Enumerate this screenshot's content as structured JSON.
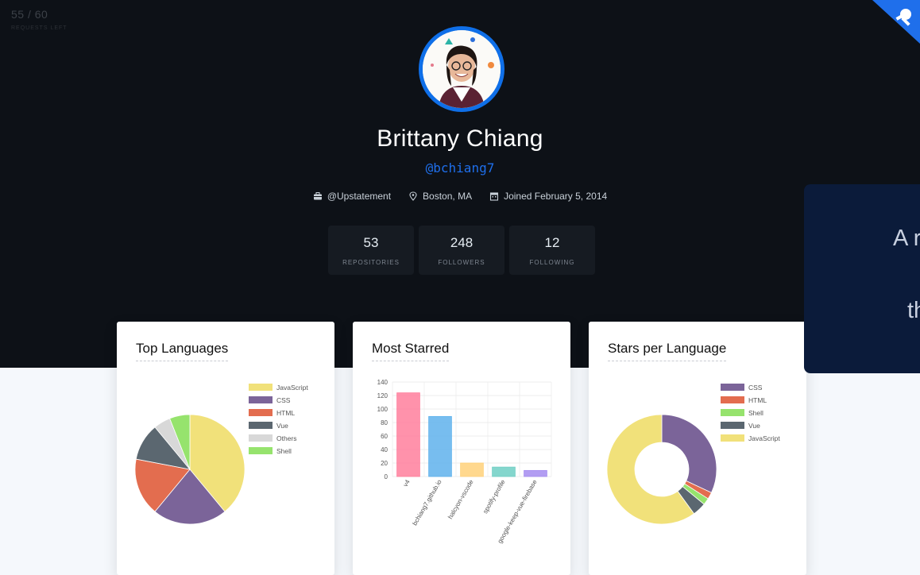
{
  "rate_limit": {
    "count": "55 / 60",
    "label": "REQUESTS LEFT"
  },
  "profile": {
    "name": "Brittany Chiang",
    "handle": "@bchiang7",
    "company": "@Upstatement",
    "location": "Boston, MA",
    "joined": "Joined February 5, 2014"
  },
  "stats": [
    {
      "value": "53",
      "label": "REPOSITORIES"
    },
    {
      "value": "248",
      "label": "FOLLOWERS"
    },
    {
      "value": "12",
      "label": "FOLLOWING"
    }
  ],
  "cards": {
    "top_languages": "Top Languages",
    "most_starred": "Most Starred",
    "stars_per_language": "Stars per Language"
  },
  "popup": {
    "line1": "A r",
    "line2": "th"
  },
  "colors": {
    "accent": "#1f6feb",
    "JavaScript": "#f1e17a",
    "CSS": "#7b6499",
    "HTML": "#e36d4f",
    "Vue": "#5b6770",
    "Others": "#d8d8d8",
    "Shell": "#96e36d"
  },
  "icons": [
    "briefcase-icon",
    "location-pin-icon",
    "calendar-icon",
    "github-octocat-icon"
  ],
  "chart_data": [
    {
      "type": "pie",
      "title": "Top Languages",
      "labels": [
        "JavaScript",
        "CSS",
        "HTML",
        "Vue",
        "Others",
        "Shell"
      ],
      "values": [
        39,
        22,
        17,
        11,
        5,
        6
      ],
      "legend": "top-right"
    },
    {
      "type": "bar",
      "title": "Most Starred",
      "categories": [
        "v4",
        "bchiang7.github.io",
        "halcyon-vscode",
        "spotify-profile",
        "google-keep-vue-firebase"
      ],
      "values": [
        124,
        89,
        20,
        14,
        9
      ],
      "ylim": [
        0,
        140
      ],
      "yticks": [
        "0",
        "20",
        "40",
        "60",
        "80",
        "100",
        "120",
        "140"
      ],
      "colors": [
        "#ff7f9c",
        "#5fb2ec",
        "#ffd17a",
        "#6fcfc4",
        "#a48cf0"
      ],
      "grid": true
    },
    {
      "type": "doughnut",
      "title": "Stars per Language",
      "labels": [
        "CSS",
        "HTML",
        "Shell",
        "Vue",
        "JavaScript"
      ],
      "values": [
        32,
        2,
        2,
        4,
        60
      ],
      "legend": "top-right"
    }
  ]
}
